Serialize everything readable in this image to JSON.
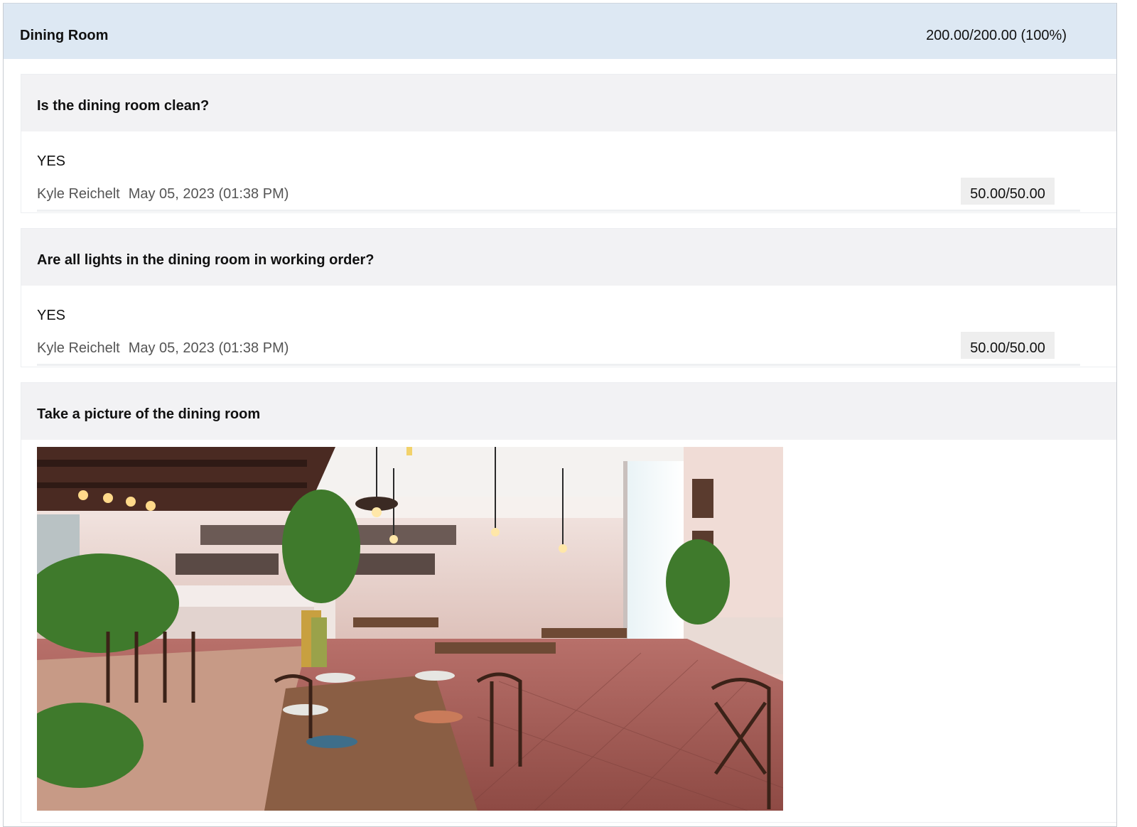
{
  "section": {
    "title": "Dining Room",
    "score": "200.00/200.00 (100%)"
  },
  "questions": [
    {
      "question": "Is the dining room clean?",
      "answer": "YES",
      "inspector": "Kyle Reichelt",
      "timestamp": "May 05, 2023 (01:38 PM)",
      "score": "50.00/50.00"
    },
    {
      "question": "Are all lights in the dining room in working order?",
      "answer": "YES",
      "inspector": "Kyle Reichelt",
      "timestamp": "May 05, 2023 (01:38 PM)",
      "score": "50.00/50.00"
    }
  ],
  "photo_question": {
    "question": "Take a picture of the dining room"
  },
  "colors": {
    "header_bg": "#dde8f3",
    "question_bg": "#f2f2f4",
    "badge_bg": "#eeeeee"
  }
}
